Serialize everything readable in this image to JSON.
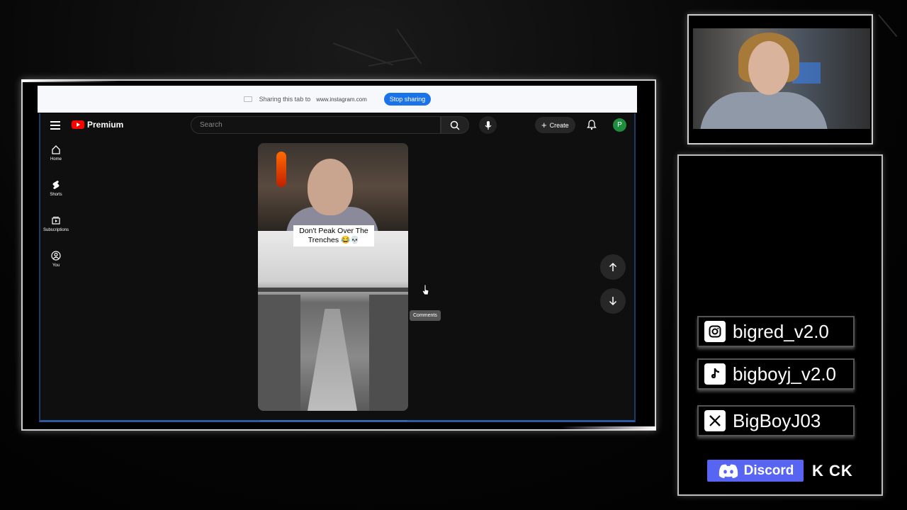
{
  "share_bar": {
    "message": "Sharing this tab to",
    "site": "www.instagram.com",
    "stop_label": "Stop sharing"
  },
  "youtube": {
    "brand": "Premium",
    "search_placeholder": "Search",
    "create_label": "Create",
    "avatar_letter": "P",
    "nav": [
      {
        "label": "Home",
        "icon": "home-icon"
      },
      {
        "label": "Shorts",
        "icon": "shorts-icon"
      },
      {
        "label": "Subscriptions",
        "icon": "subscriptions-icon"
      },
      {
        "label": "You",
        "icon": "you-icon"
      }
    ],
    "short_caption": "Don't Peak Over The Trenches 😂💀",
    "tooltip": "Comments"
  },
  "socials": {
    "instagram": "bigred_v2.0",
    "tiktok": "bigboyj_v2.0",
    "x": "BigBoyJ03",
    "discord": "Discord",
    "kick": "K CK"
  },
  "colors": {
    "accent_blue": "#1a73e8",
    "youtube_red": "#ff0000",
    "discord_blurple": "#5865f2",
    "avatar_green": "#1e8e3e"
  }
}
